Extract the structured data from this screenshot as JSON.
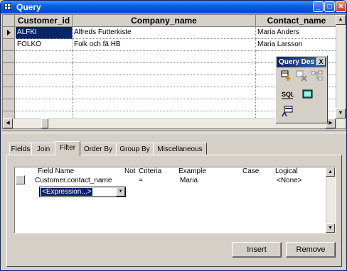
{
  "window": {
    "title": "Query",
    "min": "_",
    "max": "□",
    "close": "✕"
  },
  "grid": {
    "columns": [
      "Customer_id",
      "Company_name",
      "Contact_name"
    ],
    "rows": [
      [
        "ALFKI",
        "Alfreds Futterkiste",
        "Maria Anders"
      ],
      [
        "FOLKO",
        "Folk och fä HB",
        "Maria Larsson"
      ]
    ]
  },
  "palette": {
    "title": "Query Des",
    "close": "X",
    "icons": [
      "add-icon",
      "delete-icon",
      "relation-icon",
      "sql-icon",
      "view-icon",
      "run-icon"
    ]
  },
  "tabs": [
    "Fields",
    "Join",
    "Filter",
    "Order By",
    "Group By",
    "Miscellaneous"
  ],
  "active_tab": "Filter",
  "criteria": {
    "headers": [
      "Field Name",
      "Not",
      "Criteria",
      "Example",
      "Case",
      "Logical"
    ],
    "row": {
      "field": "Customer.contact_name",
      "criteria": "=",
      "example": "Maria",
      "logical": "<None>"
    },
    "combo_value": "<Expression...>"
  },
  "buttons": {
    "insert": "Insert",
    "remove": "Remove"
  },
  "colors": {
    "accent": "#0a246a",
    "title_blue": "#0046d5"
  }
}
